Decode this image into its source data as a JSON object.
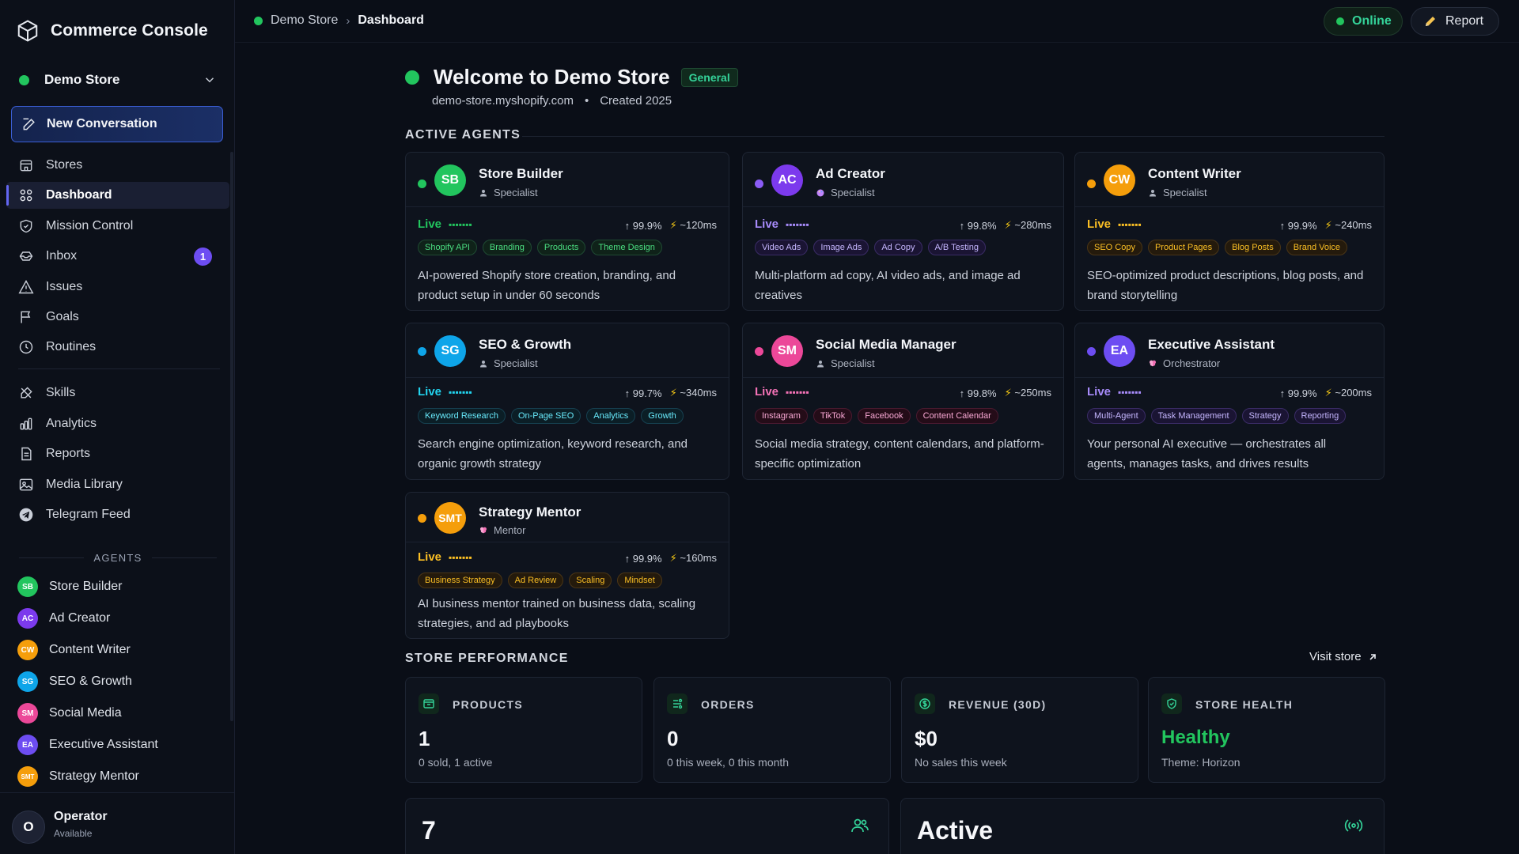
{
  "app": {
    "title": "Commerce Console"
  },
  "store_switcher": {
    "name": "Demo Store"
  },
  "sidebar": {
    "new_conversation": "New Conversation",
    "nav": [
      {
        "label": "Stores",
        "icon": "store-icon"
      },
      {
        "label": "Dashboard",
        "icon": "dashboard-grid-icon",
        "active": true
      },
      {
        "label": "Mission Control",
        "icon": "shield-icon"
      },
      {
        "label": "Inbox",
        "icon": "inbox-icon",
        "badge": "1"
      },
      {
        "label": "Issues",
        "icon": "warning-triangle-icon"
      },
      {
        "label": "Goals",
        "icon": "flag-icon"
      },
      {
        "label": "Routines",
        "icon": "clock-icon"
      }
    ],
    "nav2": [
      {
        "label": "Skills",
        "icon": "skills-icon"
      },
      {
        "label": "Analytics",
        "icon": "bar-chart-icon"
      },
      {
        "label": "Reports",
        "icon": "report-icon"
      },
      {
        "label": "Media Library",
        "icon": "image-icon"
      },
      {
        "label": "Telegram Feed",
        "icon": "telegram-icon"
      }
    ],
    "agents_heading": "AGENTS",
    "agents": [
      {
        "initials": "SB",
        "name": "Store Builder",
        "color": "#22c55e"
      },
      {
        "initials": "AC",
        "name": "Ad Creator",
        "color": "#7c3aed"
      },
      {
        "initials": "CW",
        "name": "Content Writer",
        "color": "#f59e0b"
      },
      {
        "initials": "SG",
        "name": "SEO & Growth",
        "color": "#0ea5e9"
      },
      {
        "initials": "SM",
        "name": "Social Media",
        "color": "#ec4899"
      },
      {
        "initials": "EA",
        "name": "Executive Assistant",
        "color": "#6d4df2"
      },
      {
        "initials": "SMT",
        "name": "Strategy Mentor",
        "color": "#f59e0b"
      }
    ],
    "user": {
      "initial": "O",
      "name": "Operator",
      "status": "Available"
    }
  },
  "topbar": {
    "breadcrumb": [
      "Demo Store",
      "Dashboard"
    ],
    "status_label": "Online",
    "report_label": "Report"
  },
  "welcome": {
    "title": "Welcome to Demo Store",
    "tag": "General",
    "domain": "demo-store.myshopify.com",
    "bullet": "•",
    "created": "Created 2025"
  },
  "sections": {
    "active_agents": "ACTIVE AGENTS",
    "store_performance": "STORE PERFORMANCE",
    "visit_store": "Visit store"
  },
  "agent_cards": [
    {
      "initials": "SB",
      "name": "Store Builder",
      "role": "Specialist",
      "color": "#22c55e",
      "live": "Live",
      "uptime": "99.9%",
      "latency": "~120ms",
      "tags": [
        "Shopify API",
        "Branding",
        "Products",
        "Theme Design"
      ],
      "desc": "AI-powered Shopify store creation, branding, and product setup in under 60 seconds"
    },
    {
      "initials": "AC",
      "name": "Ad Creator",
      "role": "Specialist",
      "color": "#7c3aed",
      "live": "Live",
      "uptime": "99.8%",
      "latency": "~280ms",
      "tags": [
        "Video Ads",
        "Image Ads",
        "Ad Copy",
        "A/B Testing"
      ],
      "desc": "Multi-platform ad copy, AI video ads, and image ad creatives"
    },
    {
      "initials": "CW",
      "name": "Content Writer",
      "role": "Specialist",
      "color": "#f59e0b",
      "live": "Live",
      "uptime": "99.9%",
      "latency": "~240ms",
      "tags": [
        "SEO Copy",
        "Product Pages",
        "Blog Posts",
        "Brand Voice"
      ],
      "desc": "SEO-optimized product descriptions, blog posts, and brand storytelling"
    },
    {
      "initials": "SG",
      "name": "SEO & Growth",
      "role": "Specialist",
      "color": "#0ea5e9",
      "live": "Live",
      "uptime": "99.7%",
      "latency": "~340ms",
      "tags": [
        "Keyword Research",
        "On-Page SEO",
        "Analytics",
        "Growth"
      ],
      "desc": "Search engine optimization, keyword research, and organic growth strategy"
    },
    {
      "initials": "SM",
      "name": "Social Media Manager",
      "role": "Specialist",
      "color": "#ec4899",
      "live": "Live",
      "uptime": "99.8%",
      "latency": "~250ms",
      "tags": [
        "Instagram",
        "TikTok",
        "Facebook",
        "Content Calendar"
      ],
      "desc": "Social media strategy, content calendars, and platform-specific optimization"
    },
    {
      "initials": "EA",
      "name": "Executive Assistant",
      "role": "Orchestrator",
      "color": "#6d4df2",
      "live": "Live",
      "uptime": "99.9%",
      "latency": "~200ms",
      "tags": [
        "Multi-Agent",
        "Task Management",
        "Strategy",
        "Reporting"
      ],
      "desc": "Your personal AI executive — orchestrates all agents, manages tasks, and drives results"
    },
    {
      "initials": "SMT",
      "name": "Strategy Mentor",
      "role": "Mentor",
      "color": "#f59e0b",
      "live": "Live",
      "uptime": "99.9%",
      "latency": "~160ms",
      "tags": [
        "Business Strategy",
        "Ad Review",
        "Scaling",
        "Mindset"
      ],
      "desc": "AI business mentor trained on business data, scaling strategies, and ad playbooks"
    }
  ],
  "stats": [
    {
      "label": "PRODUCTS",
      "value": "1",
      "sub": "0 sold, 1 active",
      "icon": "products-icon"
    },
    {
      "label": "ORDERS",
      "value": "0",
      "sub": "0 this week, 0 this month",
      "icon": "orders-icon"
    },
    {
      "label": "REVENUE (30D)",
      "value": "$0",
      "sub": "No sales this week",
      "icon": "revenue-icon"
    },
    {
      "label": "STORE HEALTH",
      "value": "Healthy",
      "sub": "Theme: Horizon",
      "icon": "health-shield-icon"
    }
  ],
  "bottom": {
    "agents_count": "7",
    "status": "Active"
  },
  "colors": {
    "accent_green": "#22c55e",
    "accent_purple": "#6d4df2",
    "background": "#0a0e17"
  }
}
